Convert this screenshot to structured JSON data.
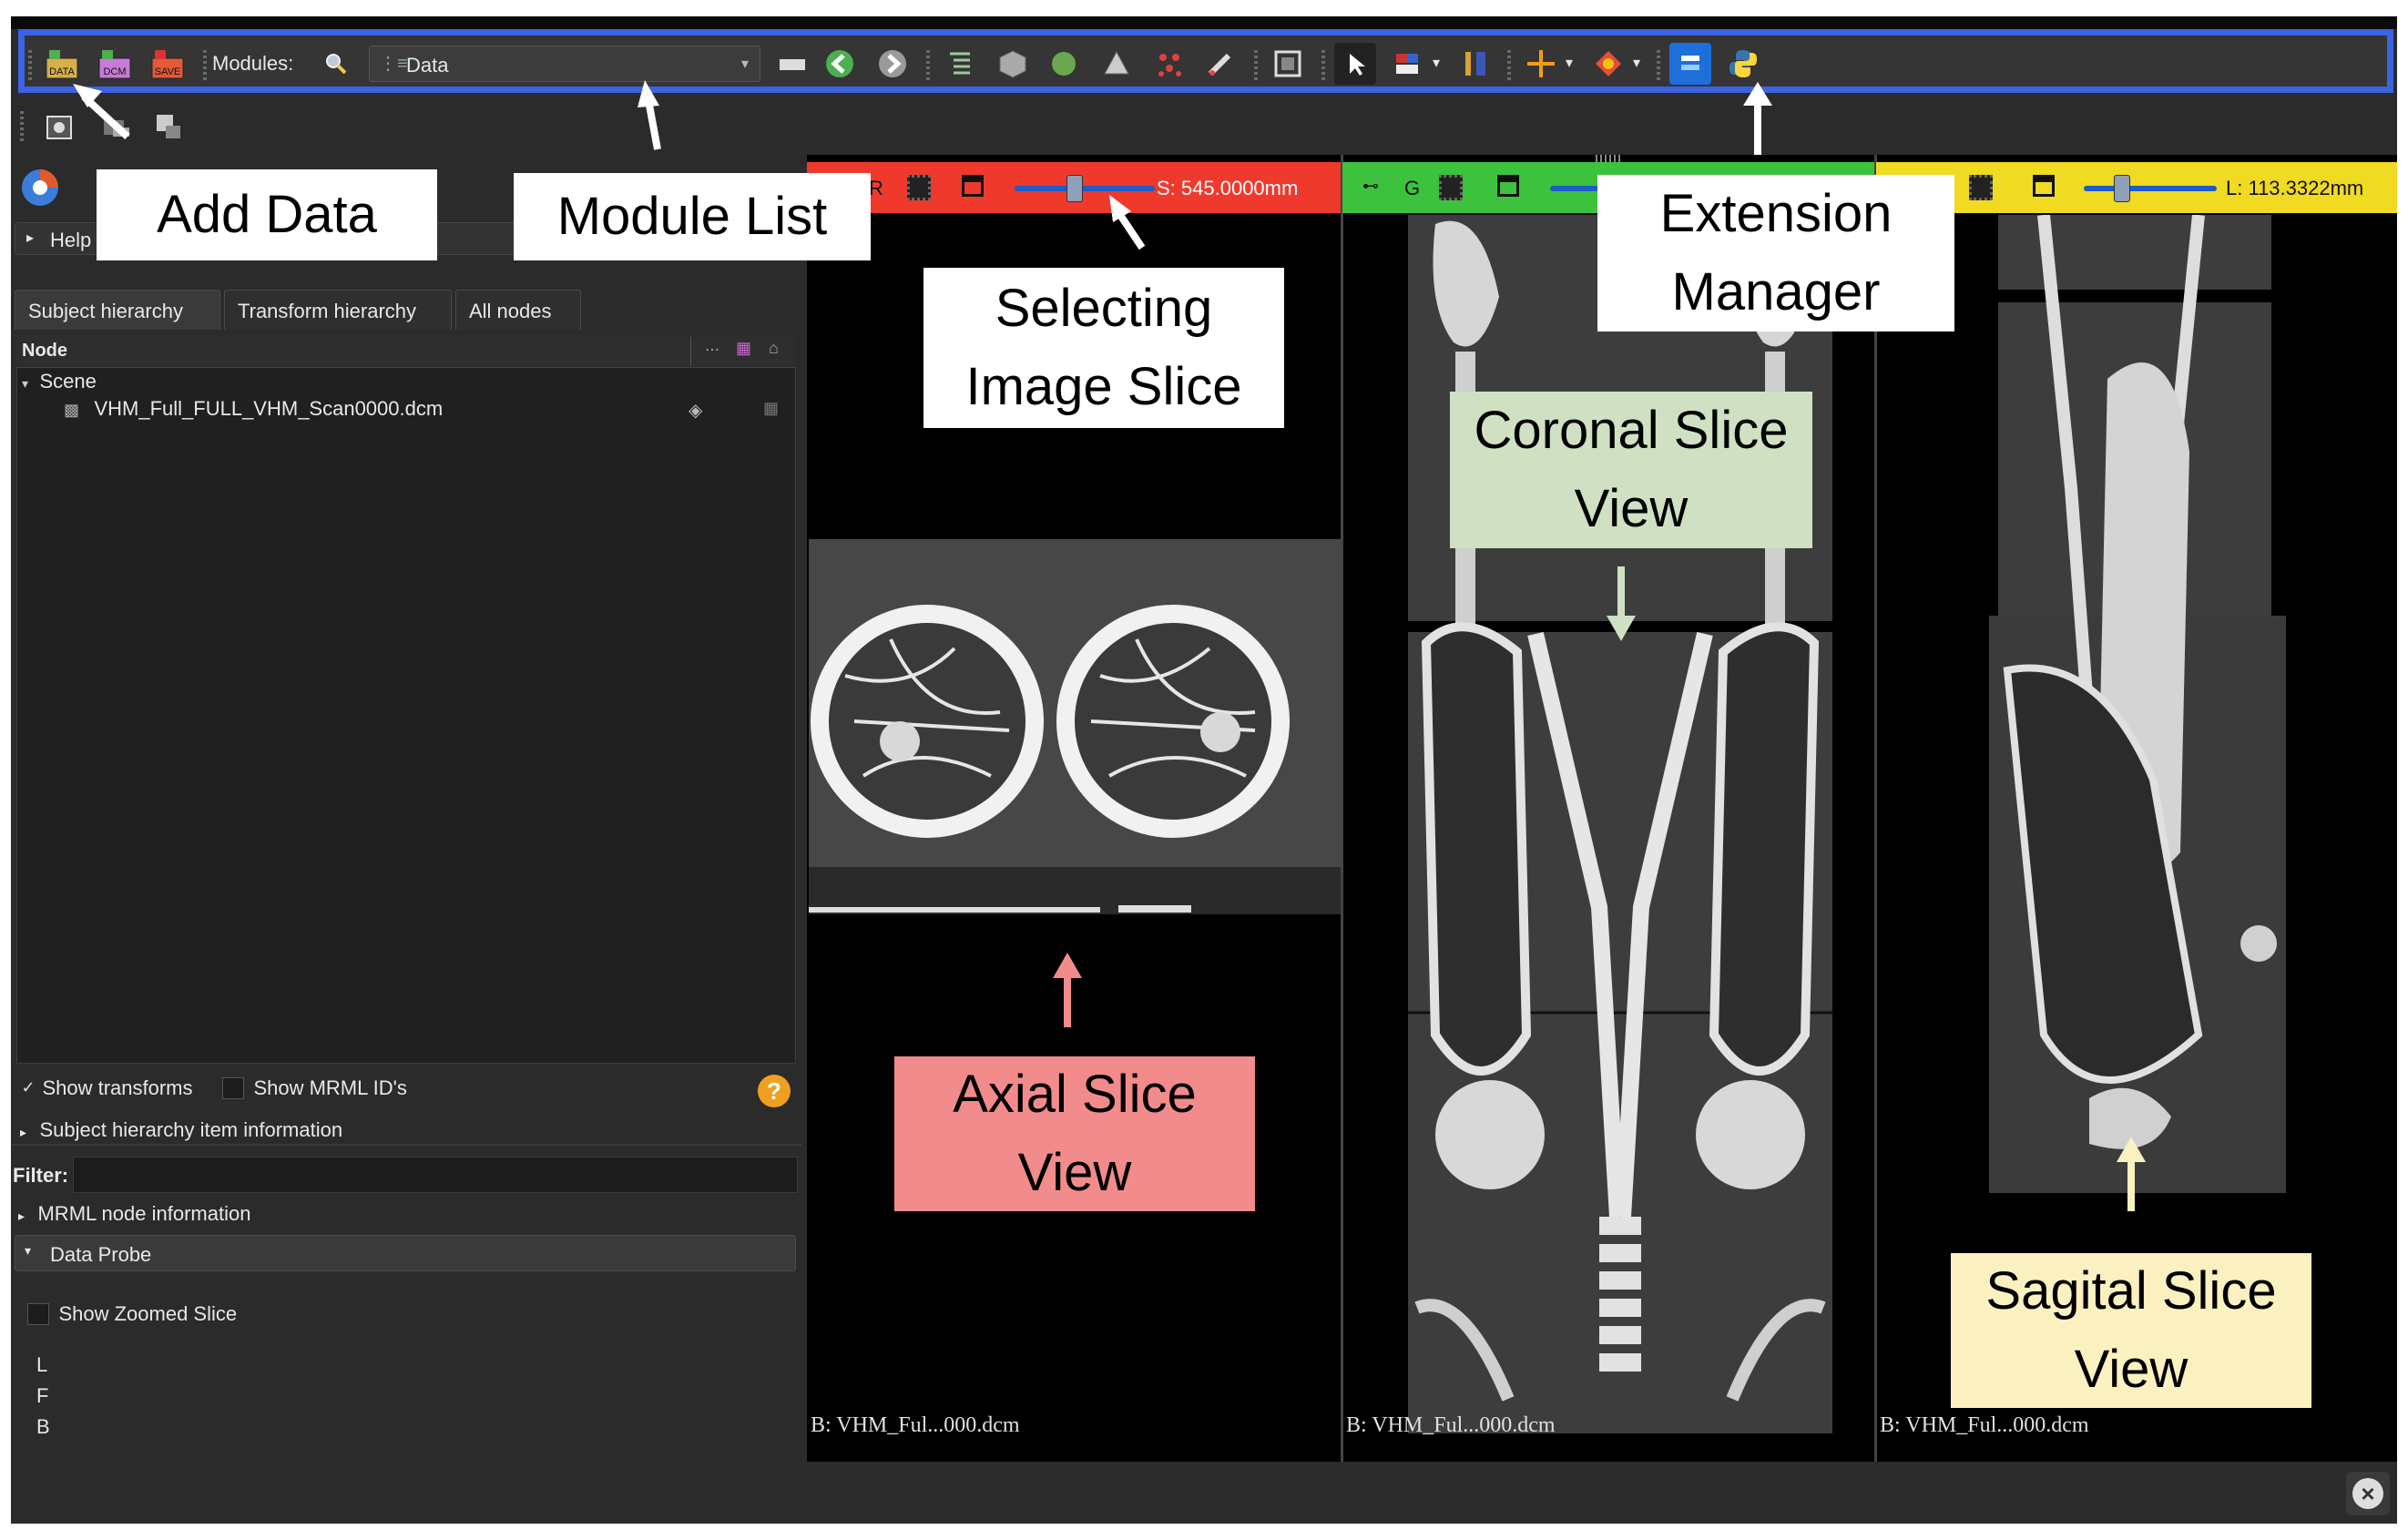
{
  "toolbar": {
    "icons": [
      "data-icon",
      "dcm-icon",
      "save-icon"
    ],
    "modules_label": "Modules:",
    "module_selected": "Data",
    "data_icon_text": "DATA",
    "dcm_icon_text": "DCM",
    "save_icon_text": "SAVE"
  },
  "left_panel": {
    "help_label": "Help",
    "tabs": [
      "Subject hierarchy",
      "Transform hierarchy",
      "All nodes"
    ],
    "tree_header": "Node",
    "scene_label": "Scene",
    "node_item": "VHM_Full_FULL_VHM_Scan0000.dcm",
    "show_transforms": "Show transforms",
    "show_mrml_ids": "Show MRML ID's",
    "subject_info": "Subject hierarchy item information",
    "filter_label": "Filter:",
    "mrml_info": "MRML node information",
    "data_probe": "Data Probe",
    "show_zoomed": "Show Zoomed Slice",
    "probe_rows": [
      "L",
      "F",
      "B"
    ]
  },
  "views": {
    "red": {
      "letter": "R",
      "offset": "S: 545.0000mm",
      "slider_fraction": 0.42,
      "label": "B: VHM_Ful...000.dcm"
    },
    "green": {
      "letter": "G",
      "label": "B: VHM_Ful...000.dcm"
    },
    "yellow": {
      "offset": "L: 113.3322mm",
      "slider_fraction": 0.28,
      "label": "B: VHM_Ful...000.dcm"
    }
  },
  "callouts": {
    "add_data": "Add Data",
    "module_list": "Module List",
    "extension_manager_1": "Extension",
    "extension_manager_2": "Manager",
    "selecting_1": "Selecting",
    "selecting_2": "Image Slice",
    "coronal_1": "Coronal Slice",
    "coronal_2": "View",
    "axial_1": "Axial Slice",
    "axial_2": "View",
    "sagital_1": "Sagital Slice",
    "sagital_2": "View"
  },
  "colors": {
    "red_bar": "#f0392d",
    "green_bar": "#3dc23d",
    "yellow_bar": "#f0da22",
    "toolbar_highlight": "#3b63e3",
    "coronal_callout": "#cfe0c3",
    "axial_callout": "#f28b8b",
    "sagital_callout": "#fbf0bf"
  }
}
